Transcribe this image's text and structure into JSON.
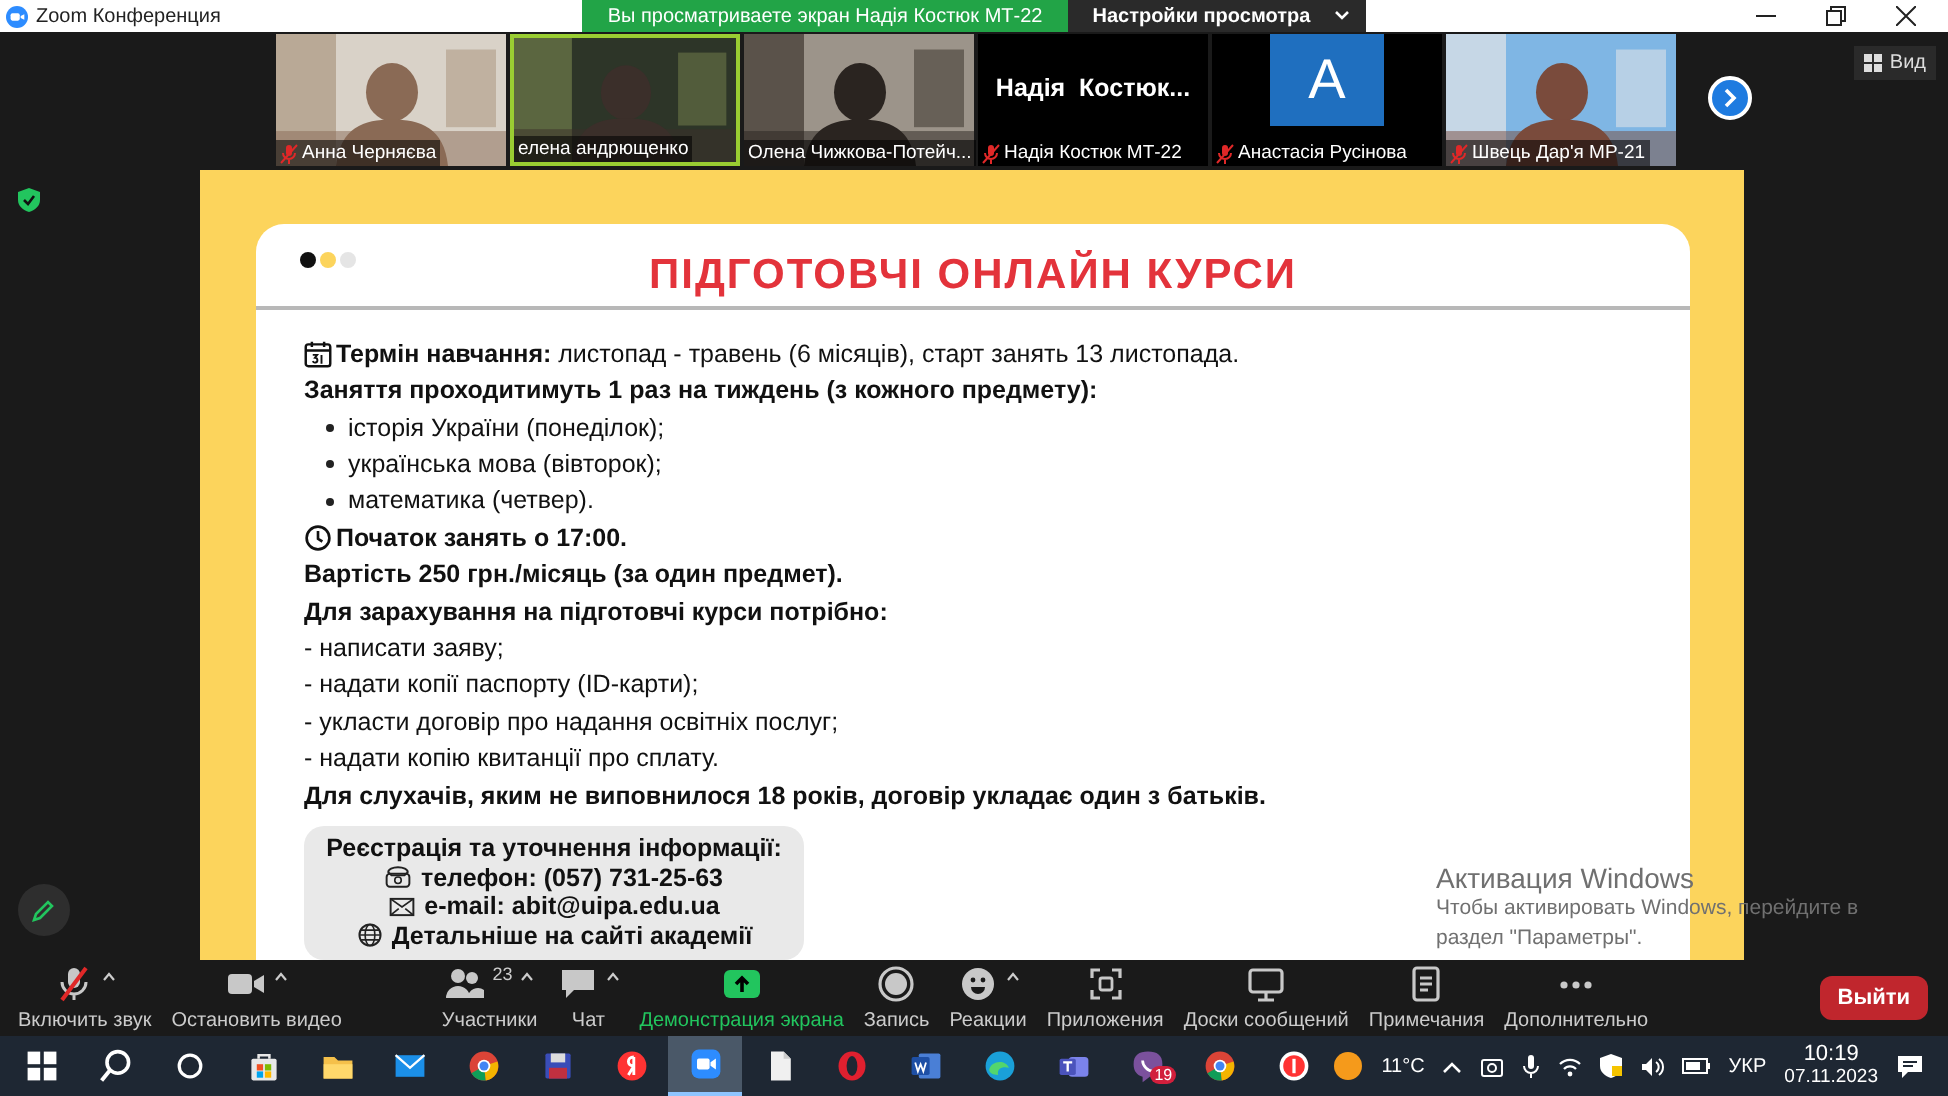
{
  "window": {
    "title": "Zoom Конференция"
  },
  "share_banner": {
    "text": "Вы просматриваете экран Надія Костюк МТ-22",
    "settings": "Настройки просмотра"
  },
  "participants": [
    {
      "kind": "video",
      "name": "Анна Черняєва",
      "muted": true,
      "active": false
    },
    {
      "kind": "video",
      "name": "елена андрющенко",
      "muted": false,
      "active": true
    },
    {
      "kind": "video",
      "name": "Олена Чижкова-Потейч...",
      "muted": false,
      "active": false
    },
    {
      "kind": "name",
      "display": "Надія  Костюк...",
      "name": "Надія Костюк МТ-22",
      "muted": true,
      "active": false
    },
    {
      "kind": "avatar",
      "initial": "A",
      "name": "Анастасія Русінова",
      "muted": true,
      "active": false
    },
    {
      "kind": "video",
      "name": "Швець Дар'я МР-21",
      "muted": true,
      "active": false
    }
  ],
  "view_button": "Вид",
  "slide": {
    "title": "ПІДГОТОВЧІ ОНЛАЙН КУРСИ",
    "lines": [
      {
        "kind": "marked",
        "bold": false,
        "text": "**Термін навчання:** листопад - травень (6 місяців), старт занять 13 листопада."
      },
      {
        "kind": "para",
        "bold": true,
        "text": "Заняття проходитимуть 1 раз на тиждень (з кожного предмету):"
      },
      {
        "kind": "bullet",
        "bold": false,
        "text": "історія України (понеділок);"
      },
      {
        "kind": "bullet",
        "bold": false,
        "text": "українська мова (вівторок);"
      },
      {
        "kind": "bullet",
        "bold": false,
        "text": "математика (четвер)."
      },
      {
        "kind": "marked",
        "bold": true,
        "text": "Початок занять о 17:00."
      },
      {
        "kind": "para",
        "bold": true,
        "text": "Вартість 250 грн./місяць (за один предмет)."
      },
      {
        "kind": "para",
        "bold": true,
        "text": "Для зарахування на підготовчі курси потрібно:"
      },
      {
        "kind": "para",
        "bold": false,
        "text": "- написати заяву;"
      },
      {
        "kind": "para",
        "bold": false,
        "text": "- надати копії паспорту (ID-карти);"
      },
      {
        "kind": "para",
        "bold": false,
        "text": "- укласти договір про надання освітніх послуг;"
      },
      {
        "kind": "para",
        "bold": false,
        "text": "- надати копію квитанції про сплату."
      },
      {
        "kind": "para",
        "bold": true,
        "text": "Для слухачів, яким не виповнилося 18 років, договір укладає один з батьків."
      }
    ],
    "contact": {
      "title": "Реєстрація та уточнення інформації:",
      "lines": [
        "телефон: (057) 731-25-63",
        "e-mail: abit@uipa.edu.ua",
        "Детальніше на сайті академії"
      ]
    }
  },
  "activation_notice": {
    "title": "Активация Windows",
    "lines": [
      "Чтобы активировать Windows, перейдите в",
      "раздел \"Параметры\"."
    ]
  },
  "toolbar": [
    {
      "label": "Включить звук",
      "caret": true,
      "muted": true
    },
    {
      "label": "Остановить видео",
      "caret": true
    },
    {
      "label": "Участники",
      "caret": true,
      "badge": "23"
    },
    {
      "label": "Чат",
      "caret": true
    },
    {
      "label": "Демонстрация экрана",
      "caret": false,
      "active": true
    },
    {
      "label": "Запись",
      "caret": false
    },
    {
      "label": "Реакции",
      "caret": true
    },
    {
      "label": "Приложения",
      "caret": false
    },
    {
      "label": "Доски сообщений",
      "caret": false
    },
    {
      "label": "Примечания",
      "caret": false
    },
    {
      "label": "Дополнительно",
      "caret": false
    }
  ],
  "leave_button": "Выйти",
  "taskbar": {
    "apps": [
      {
        "kind": "start",
        "active": false
      },
      {
        "kind": "search",
        "active": false
      },
      {
        "kind": "taskview",
        "active": false
      },
      {
        "kind": "store",
        "active": false
      },
      {
        "kind": "folder",
        "active": false
      },
      {
        "kind": "mail",
        "active": false
      },
      {
        "kind": "chrome",
        "active": false
      },
      {
        "kind": "floppy",
        "active": false
      },
      {
        "kind": "yandex",
        "active": false
      },
      {
        "kind": "zoom",
        "active": true
      },
      {
        "kind": "file",
        "active": false
      },
      {
        "kind": "opera",
        "active": false
      },
      {
        "kind": "word",
        "active": false
      },
      {
        "kind": "edge",
        "active": false
      },
      {
        "kind": "teams",
        "active": false
      },
      {
        "kind": "viber",
        "active": false,
        "badge": "19"
      },
      {
        "kind": "chrome",
        "active": false
      },
      {
        "kind": "ybrowser",
        "active": false
      }
    ],
    "temperature": "11°C",
    "language": "УКР",
    "time": "10:19",
    "date": "07.11.2023"
  }
}
